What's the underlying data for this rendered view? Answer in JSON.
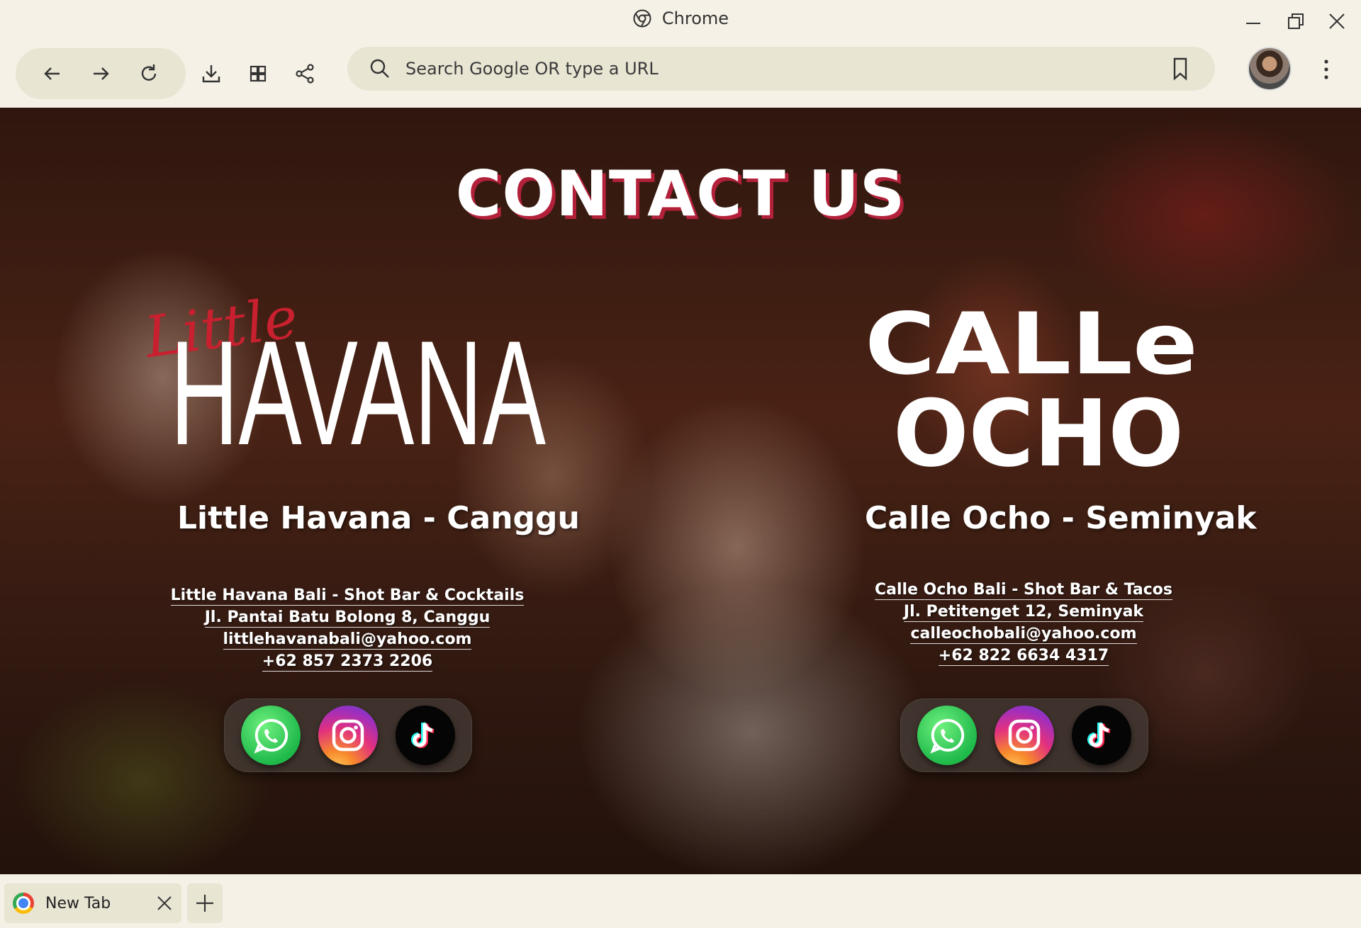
{
  "window": {
    "title": "Chrome",
    "minimize_icon": "minimize-icon",
    "restore_icon": "restore-icon",
    "close_icon": "close-icon"
  },
  "toolbar": {
    "back_icon": "arrow-left-icon",
    "forward_icon": "arrow-right-icon",
    "reload_icon": "reload-icon",
    "download_icon": "download-icon",
    "extensions_icon": "extensions-icon",
    "share_icon": "share-icon",
    "search_icon": "search-icon",
    "bookmark_icon": "bookmark-icon",
    "menu_icon": "more-vertical-icon"
  },
  "omnibox": {
    "placeholder": "Search Google OR type a URL",
    "value": ""
  },
  "page": {
    "heading": "CONTACT US",
    "venues": [
      {
        "logo_script": "Little",
        "logo_main": "HAVANA",
        "name": "Little Havana - Canggu",
        "lines": [
          "Little Havana Bali - Shot Bar & Cocktails",
          "Jl. Pantai Batu Bolong 8, Canggu",
          "littlehavanabali@yahoo.com",
          "+62 857 2373 2206"
        ],
        "social": [
          "whatsapp-icon",
          "instagram-icon",
          "tiktok-icon"
        ]
      },
      {
        "logo_line1": "CALLe",
        "logo_line2": "OCHO",
        "name": "Calle Ocho - Seminyak",
        "lines": [
          "Calle Ocho Bali - Shot Bar & Tacos",
          "Jl. Petitenget 12, Seminyak",
          "calleochobali@yahoo.com",
          "+62 822 6634 4317"
        ],
        "social": [
          "whatsapp-icon",
          "instagram-icon",
          "tiktok-icon"
        ]
      }
    ],
    "colors": {
      "heading_shadow": "#b3203a",
      "script_red": "#c8202f",
      "whatsapp": "#25d366",
      "tiktok": "#050505"
    }
  },
  "tabs": [
    {
      "label": "New Tab",
      "active": true
    }
  ]
}
